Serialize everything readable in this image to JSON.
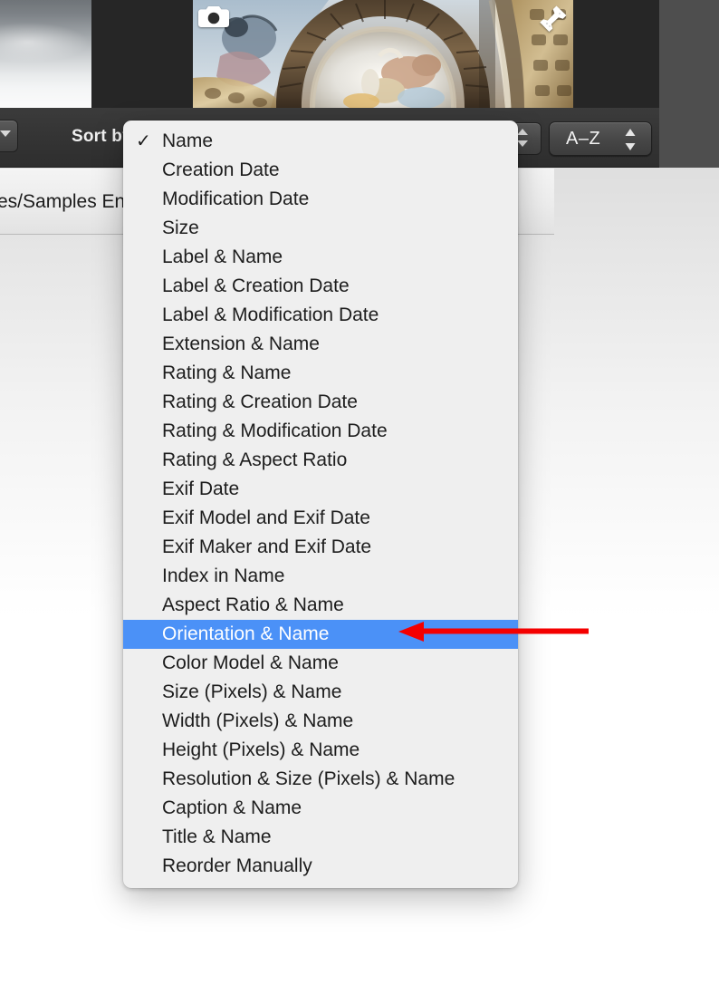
{
  "window": {
    "app_context": "photo-browser-sort-menu"
  },
  "media_strip": {
    "thumbnails": [
      {
        "name": "sky-clouds-thumbnail",
        "alt": "grayscale cloudy sky photograph"
      },
      {
        "name": "fresco-ceiling-thumbnail",
        "alt": "baroque painted church ceiling fresco with dome"
      }
    ],
    "overlay_icons": [
      {
        "name": "camera-icon",
        "label": "camera"
      },
      {
        "name": "pin-icon",
        "label": "pin"
      }
    ]
  },
  "toolbar": {
    "sort_by_label": "Sort by",
    "left_button_icon": "chevron-down-icon",
    "stepper_icon": "up-down-arrows-icon",
    "order_popup_value": "A–Z",
    "order_popup_icon": "up-down-arrows-icon"
  },
  "pathbar": {
    "path_text": "es/Samples En"
  },
  "sort_menu": {
    "checked_item": "Name",
    "selected_item": "Orientation & Name",
    "highlight_color": "#4b91f7",
    "items": [
      {
        "label": "Name",
        "checked": true,
        "selected": false
      },
      {
        "label": "Creation Date",
        "checked": false,
        "selected": false
      },
      {
        "label": "Modification Date",
        "checked": false,
        "selected": false
      },
      {
        "label": "Size",
        "checked": false,
        "selected": false
      },
      {
        "label": "Label & Name",
        "checked": false,
        "selected": false
      },
      {
        "label": "Label & Creation Date",
        "checked": false,
        "selected": false
      },
      {
        "label": "Label & Modification Date",
        "checked": false,
        "selected": false
      },
      {
        "label": "Extension & Name",
        "checked": false,
        "selected": false
      },
      {
        "label": "Rating & Name",
        "checked": false,
        "selected": false
      },
      {
        "label": "Rating & Creation Date",
        "checked": false,
        "selected": false
      },
      {
        "label": "Rating & Modification Date",
        "checked": false,
        "selected": false
      },
      {
        "label": "Rating & Aspect Ratio",
        "checked": false,
        "selected": false
      },
      {
        "label": "Exif Date",
        "checked": false,
        "selected": false
      },
      {
        "label": "Exif Model and Exif Date",
        "checked": false,
        "selected": false
      },
      {
        "label": "Exif Maker and Exif Date",
        "checked": false,
        "selected": false
      },
      {
        "label": "Index in Name",
        "checked": false,
        "selected": false
      },
      {
        "label": "Aspect Ratio & Name",
        "checked": false,
        "selected": false
      },
      {
        "label": "Orientation & Name",
        "checked": false,
        "selected": true
      },
      {
        "label": "Color Model & Name",
        "checked": false,
        "selected": false
      },
      {
        "label": "Size (Pixels) & Name",
        "checked": false,
        "selected": false
      },
      {
        "label": "Width (Pixels) & Name",
        "checked": false,
        "selected": false
      },
      {
        "label": "Height (Pixels) & Name",
        "checked": false,
        "selected": false
      },
      {
        "label": "Resolution & Size (Pixels) & Name",
        "checked": false,
        "selected": false
      },
      {
        "label": "Caption & Name",
        "checked": false,
        "selected": false
      },
      {
        "label": "Title & Name",
        "checked": false,
        "selected": false
      },
      {
        "label": "Reorder Manually",
        "checked": false,
        "selected": false
      }
    ]
  },
  "annotation": {
    "arrow_color": "#f40000",
    "points_to": "Orientation & Name"
  }
}
